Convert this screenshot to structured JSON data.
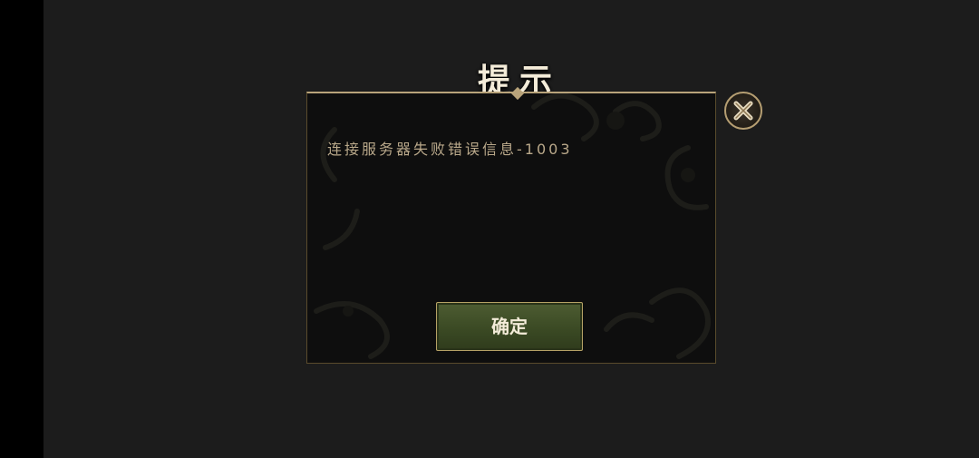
{
  "dialog": {
    "title": "提示",
    "message": "连接服务器失败错误信息-1003",
    "confirm_label": "确定",
    "close_icon": "close-icon"
  },
  "colors": {
    "background": "#1c1c1c",
    "panel": "#0e0e0e",
    "gold": "#b59e72",
    "button_green": "#3b4a24",
    "text": "#b9a88a"
  }
}
